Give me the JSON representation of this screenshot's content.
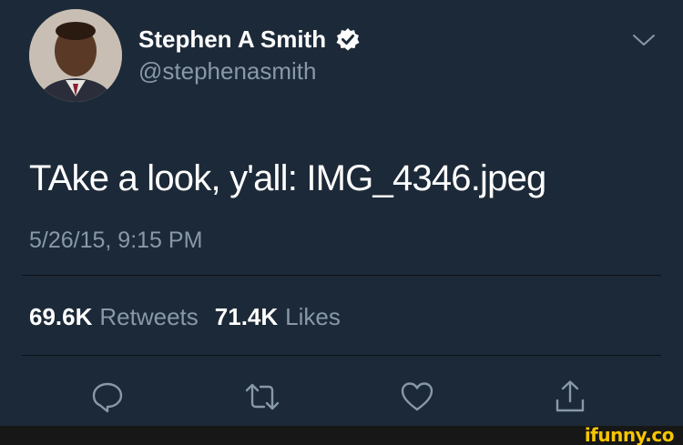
{
  "user": {
    "display_name": "Stephen A Smith",
    "handle": "@stephenasmith",
    "verified": true
  },
  "tweet": {
    "text": "TAke a look, y'all: IMG_4346.jpeg",
    "timestamp": "5/26/15, 9:15 PM"
  },
  "stats": {
    "retweets_count": "69.6K",
    "retweets_label": "Retweets",
    "likes_count": "71.4K",
    "likes_label": "Likes"
  },
  "actions": {
    "reply_icon": "reply-icon",
    "retweet_icon": "retweet-icon",
    "like_icon": "heart-icon",
    "share_icon": "share-icon"
  },
  "watermark": {
    "text": "ifunny.co"
  },
  "colors": {
    "background": "#1c2938",
    "secondary_text": "#8899a6",
    "verified_badge": "#ffffff",
    "watermark": "#f7c600"
  }
}
